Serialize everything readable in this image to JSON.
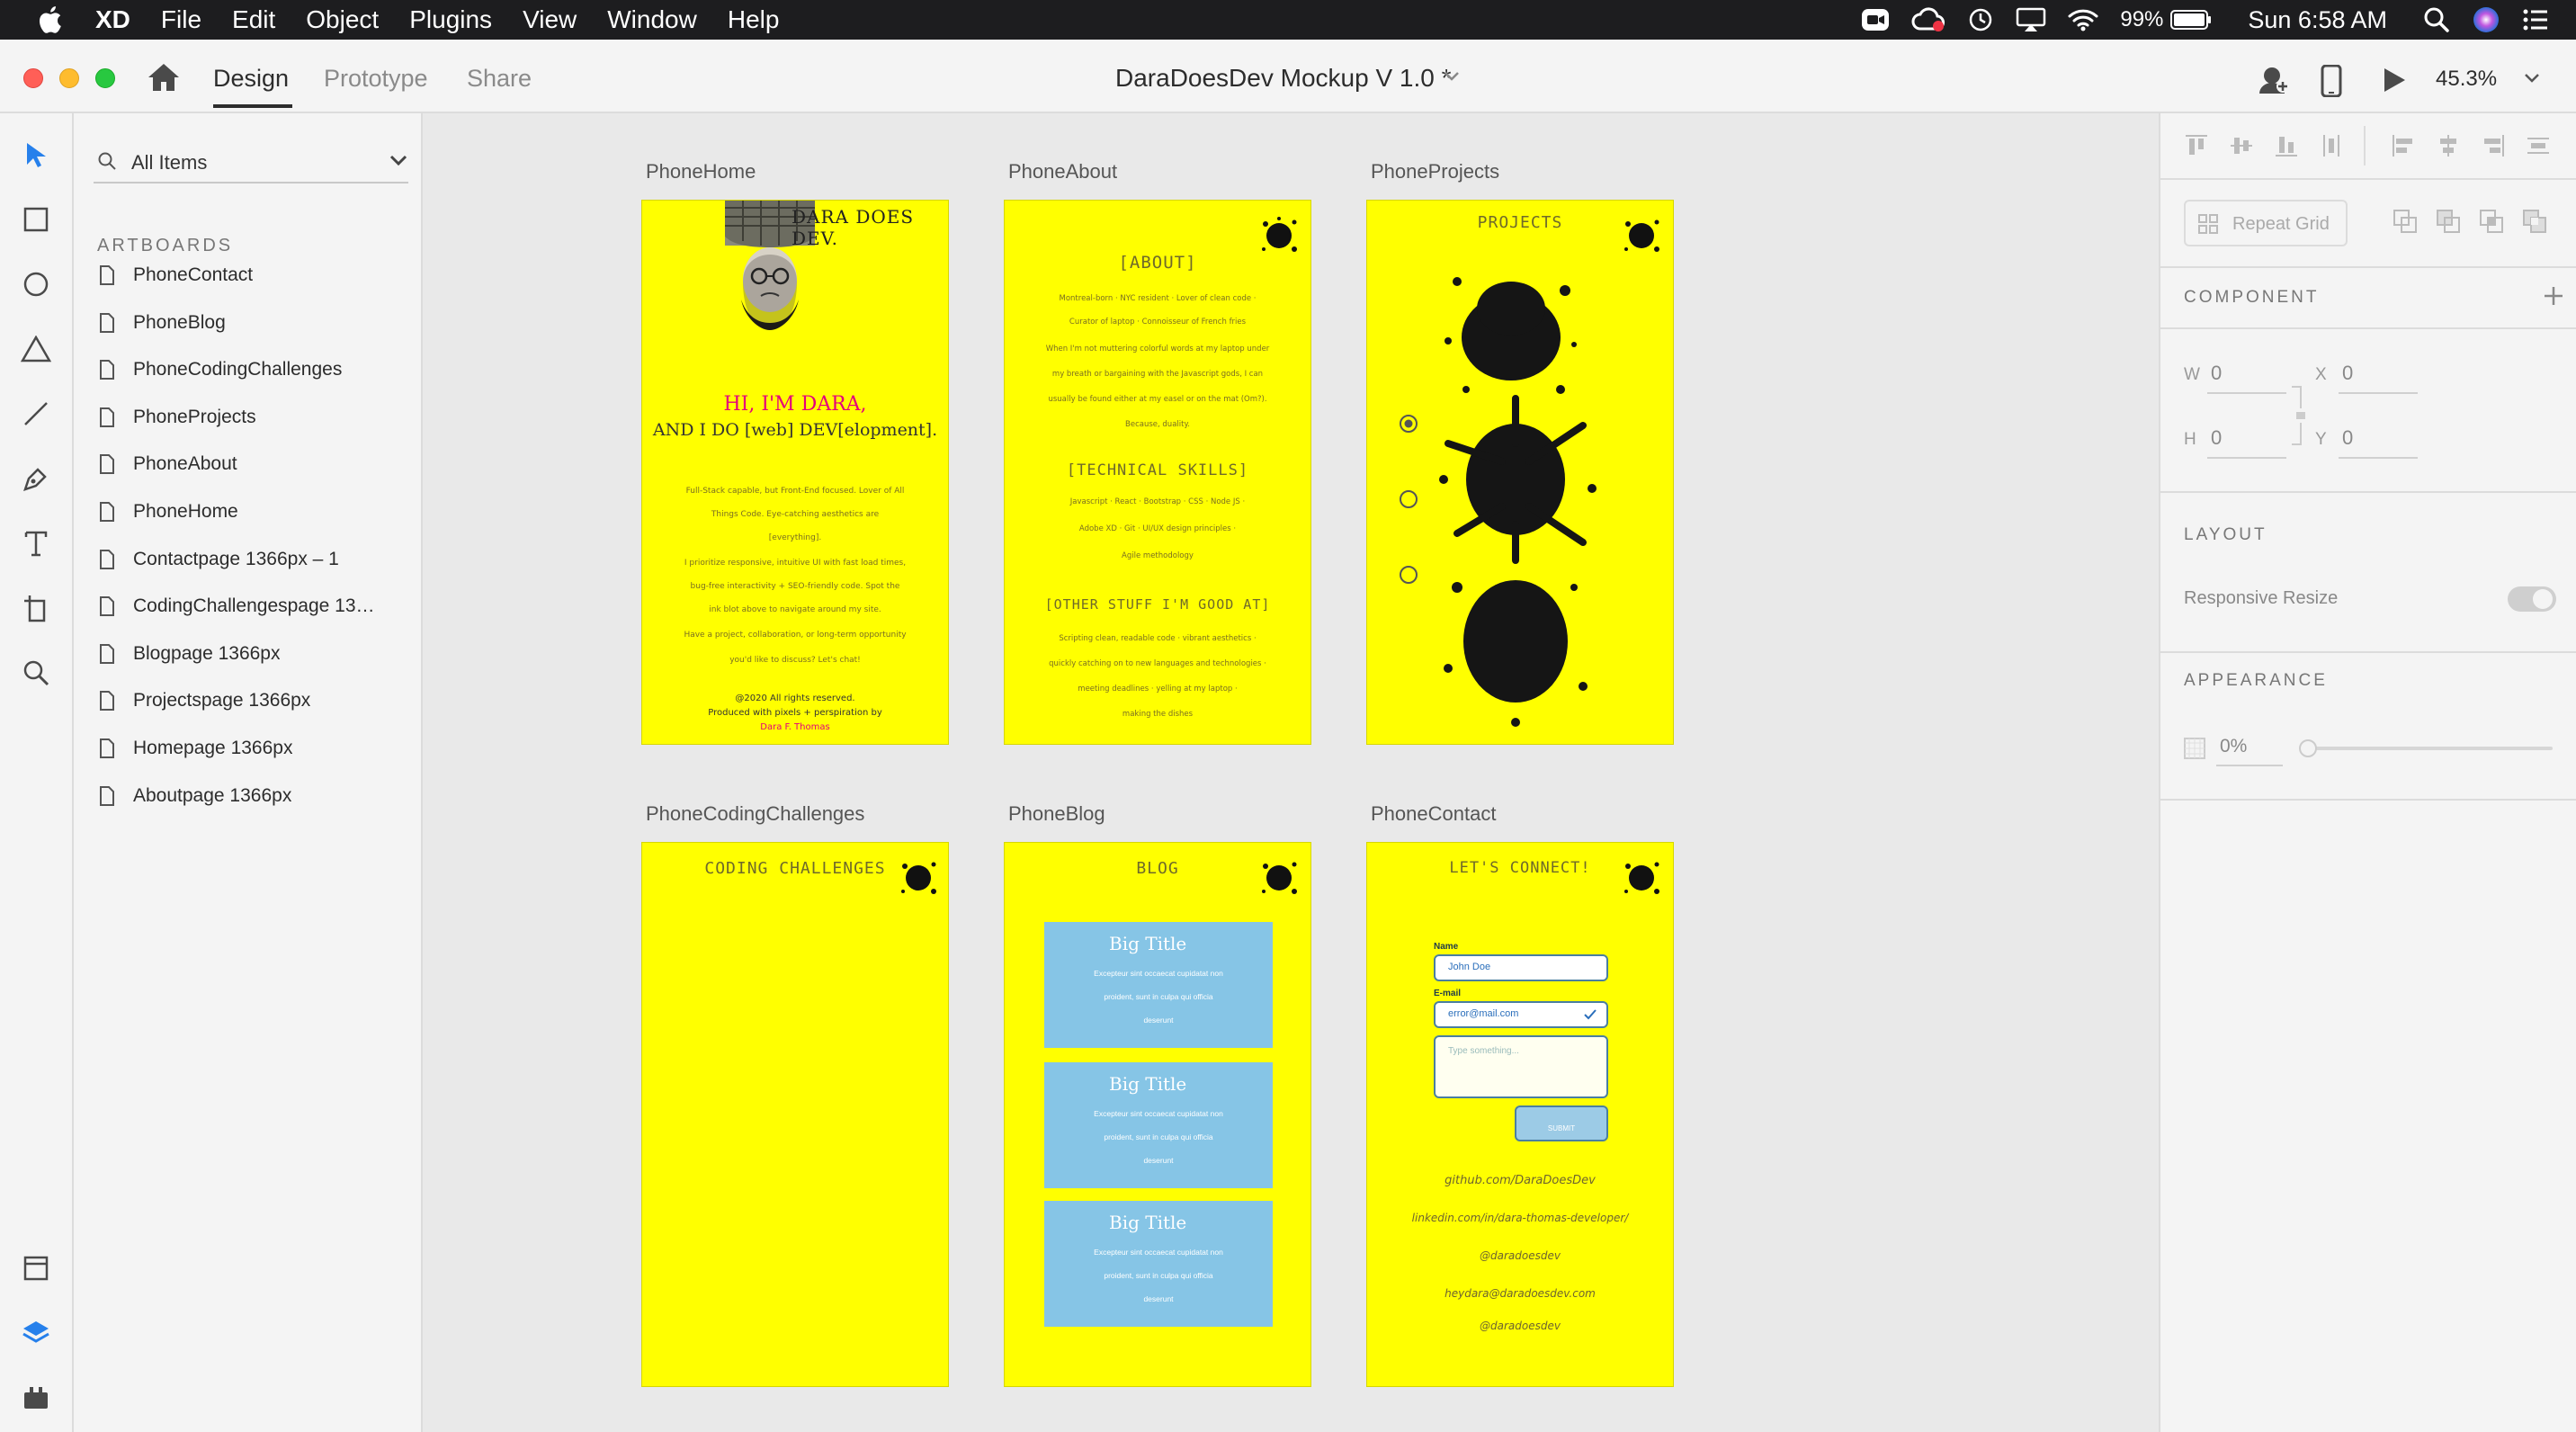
{
  "menubar": {
    "app": "XD",
    "items": [
      "File",
      "Edit",
      "Object",
      "Plugins",
      "View",
      "Window",
      "Help"
    ],
    "battery": "99%",
    "clock": "Sun 6:58 AM"
  },
  "titlebar": {
    "tabs": [
      "Design",
      "Prototype",
      "Share"
    ],
    "active_tab": "Design",
    "document_title": "DaraDoesDev Mockup V 1.0 *",
    "zoom": "45.3%"
  },
  "layers": {
    "filter_label": "All Items",
    "heading": "ARTBOARDS",
    "items": [
      "PhoneContact",
      "PhoneBlog",
      "PhoneCodingChallenges",
      "PhoneProjects",
      "PhoneAbout",
      "PhoneHome",
      "Contactpage 1366px – 1",
      "CodingChallengespage 13…",
      "Blogpage 1366px",
      "Projectspage 1366px",
      "Homepage 1366px",
      "Aboutpage 1366px"
    ]
  },
  "canvas": {
    "artboard_titles": {
      "home": "PhoneHome",
      "about": "PhoneAbout",
      "projects": "PhoneProjects",
      "coding": "PhoneCodingChallenges",
      "blog": "PhoneBlog",
      "contact": "PhoneContact"
    },
    "home": {
      "logo": "DARA DOES DEV.",
      "hello_line1": "HI, I'M DARA,",
      "hello_line2": "AND I DO [web] DEV[elopment].",
      "body": [
        "Full-Stack capable, but Front-End focused. Lover of All",
        "Things Code. Eye-catching aesthetics are",
        "[everything].",
        "I prioritize responsive, intuitive UI with fast load times,",
        "bug-free interactivity + SEO-friendly code. Spot the",
        "ink blot above to navigate around my site.",
        "Have a project, collaboration, or long-term opportunity",
        "you'd like to discuss? Let's chat!"
      ],
      "footer1": "@2020 All rights reserved.",
      "footer2": "Produced with pixels + perspiration by",
      "footer3": "Dara F. Thomas"
    },
    "about": {
      "heading1": "[ABOUT]",
      "about_lines": [
        "Montreal-born · NYC resident · Lover of clean code ·",
        "Curator of laptop · Connoisseur of French fries",
        "When I'm not muttering colorful words at my laptop under",
        "my breath or bargaining with the Javascript gods, I can",
        "usually be found either at my easel or on the mat (Om?).",
        "Because, duality."
      ],
      "heading2": "[TECHNICAL SKILLS]",
      "skills_lines": [
        "Javascript · React · Bootstrap · CSS · Node JS ·",
        "Adobe XD · Git · UI/UX design principles ·",
        "Agile methodology"
      ],
      "heading3": "[OTHER STUFF I'M GOOD AT]",
      "other_lines": [
        "Scripting clean, readable code · vibrant aesthetics ·",
        "quickly catching on to new languages and technologies ·",
        "meeting deadlines · yelling at my laptop ·",
        "making the dishes"
      ]
    },
    "projects": {
      "heading": "PROJECTS"
    },
    "coding": {
      "heading": "CODING CHALLENGES"
    },
    "blog": {
      "heading": "BLOG",
      "posts": [
        {
          "title": "Big Title",
          "text1": "Excepteur sint occaecat cupidatat non",
          "text2": "proident, sunt in culpa qui officia",
          "text3": "deserunt"
        },
        {
          "title": "Big Title",
          "text1": "Excepteur sint occaecat cupidatat non",
          "text2": "proident, sunt in culpa qui officia",
          "text3": "deserunt"
        },
        {
          "title": "Big Title",
          "text1": "Excepteur sint occaecat cupidatat non",
          "text2": "proident, sunt in culpa qui officia",
          "text3": "deserunt"
        }
      ]
    },
    "contact": {
      "heading": "LET'S CONNECT!",
      "name_label": "Name",
      "name_value": "John Doe",
      "email_label": "E-mail",
      "email_value": "error@mail.com",
      "message_placeholder": "Type something...",
      "submit_label": "SUBMIT",
      "links": [
        "github.com/DaraDoesDev",
        "linkedin.com/in/dara-thomas-developer/",
        "@daradoesdev",
        "heydara@daradoesdev.com",
        "@daradoesdev"
      ]
    }
  },
  "props": {
    "repeat_grid": "Repeat Grid",
    "component": "COMPONENT",
    "w_label": "W",
    "w_value": "0",
    "x_label": "X",
    "x_value": "0",
    "h_label": "H",
    "h_value": "0",
    "y_label": "Y",
    "y_value": "0",
    "layout": "LAYOUT",
    "responsive_resize": "Responsive Resize",
    "appearance": "APPEARANCE",
    "opacity": "0%"
  },
  "colors": {
    "artboard_yellow": "#ffff00",
    "accent_blue": "#2680eb",
    "blog_card": "#86c5e6",
    "pink": "#e4007c"
  }
}
